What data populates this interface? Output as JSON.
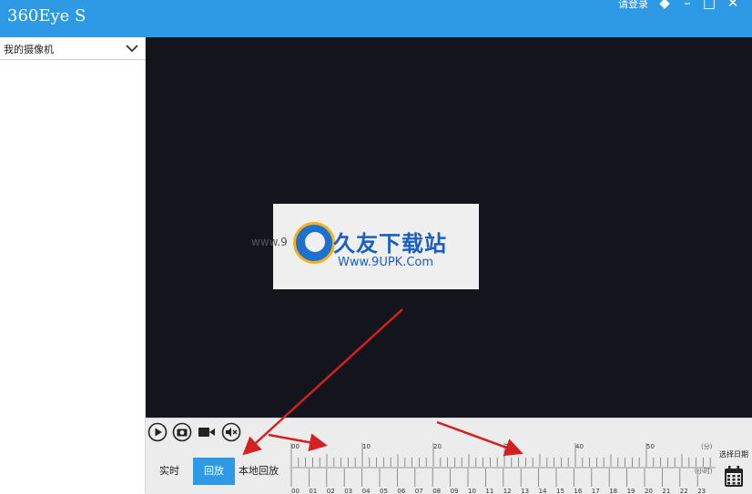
{
  "window": {
    "title": "360Eye S",
    "login": "请登录",
    "accent": "#2e9ae6"
  },
  "sidebar": {
    "title": "我的摄像机"
  },
  "watermark": {
    "left_text": "www.9",
    "brand": "久友下载站",
    "url": "Www.9UPK.Com"
  },
  "controls": {
    "icons": [
      "play-icon",
      "camera-icon",
      "video-record-icon",
      "mute-icon"
    ],
    "modes": {
      "live": "实时",
      "playback": "回放",
      "local_playback": "本地回放"
    },
    "select_date": "选择日期"
  },
  "timeline": {
    "minute_label": "(分)",
    "hour_label": "(小时)",
    "minute_ticks": [
      "00",
      "10",
      "20",
      "30",
      "40",
      "50"
    ],
    "hour_ticks": [
      "00",
      "01",
      "02",
      "03",
      "04",
      "05",
      "06",
      "07",
      "08",
      "09",
      "10",
      "11",
      "12",
      "13",
      "14",
      "15",
      "16",
      "17",
      "18",
      "19",
      "20",
      "21",
      "22",
      "23"
    ]
  }
}
